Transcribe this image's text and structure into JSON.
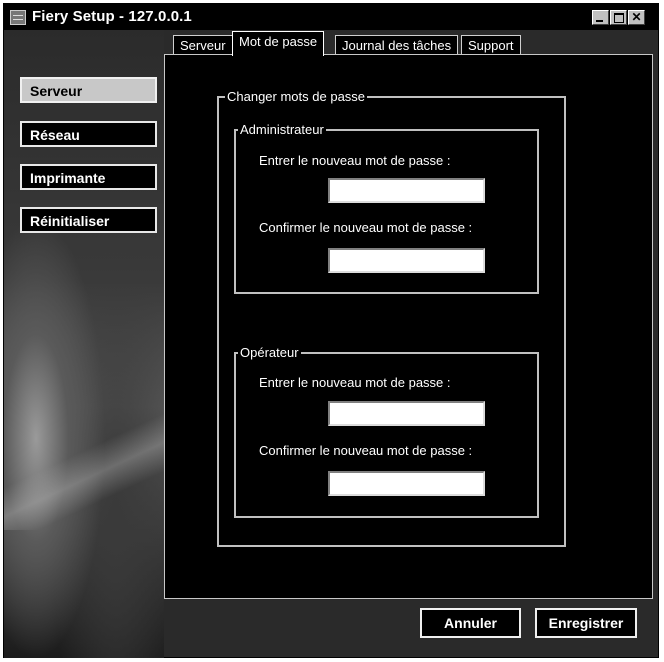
{
  "window": {
    "title": "Fiery Setup - 127.0.0.1"
  },
  "sidebar": {
    "items": [
      {
        "label": "Serveur",
        "active": true
      },
      {
        "label": "Réseau",
        "active": false
      },
      {
        "label": "Imprimante",
        "active": false
      },
      {
        "label": "Réinitialiser",
        "active": false
      }
    ]
  },
  "tabs": [
    {
      "label": "Serveur"
    },
    {
      "label": "Mot de passe",
      "active": true
    },
    {
      "label": "Journal des tâches"
    },
    {
      "label": "Support"
    }
  ],
  "form": {
    "group_title": "Changer mots de passe",
    "admin": {
      "title": "Administrateur",
      "new_label": "Entrer le nouveau mot de passe :",
      "confirm_label": "Confirmer le nouveau mot de passe :"
    },
    "operator": {
      "title": "Opérateur",
      "new_label": "Entrer le nouveau mot de passe :",
      "confirm_label": "Confirmer le nouveau mot de passe :"
    }
  },
  "footer": {
    "cancel_label": "Annuler",
    "save_label": "Enregistrer"
  }
}
